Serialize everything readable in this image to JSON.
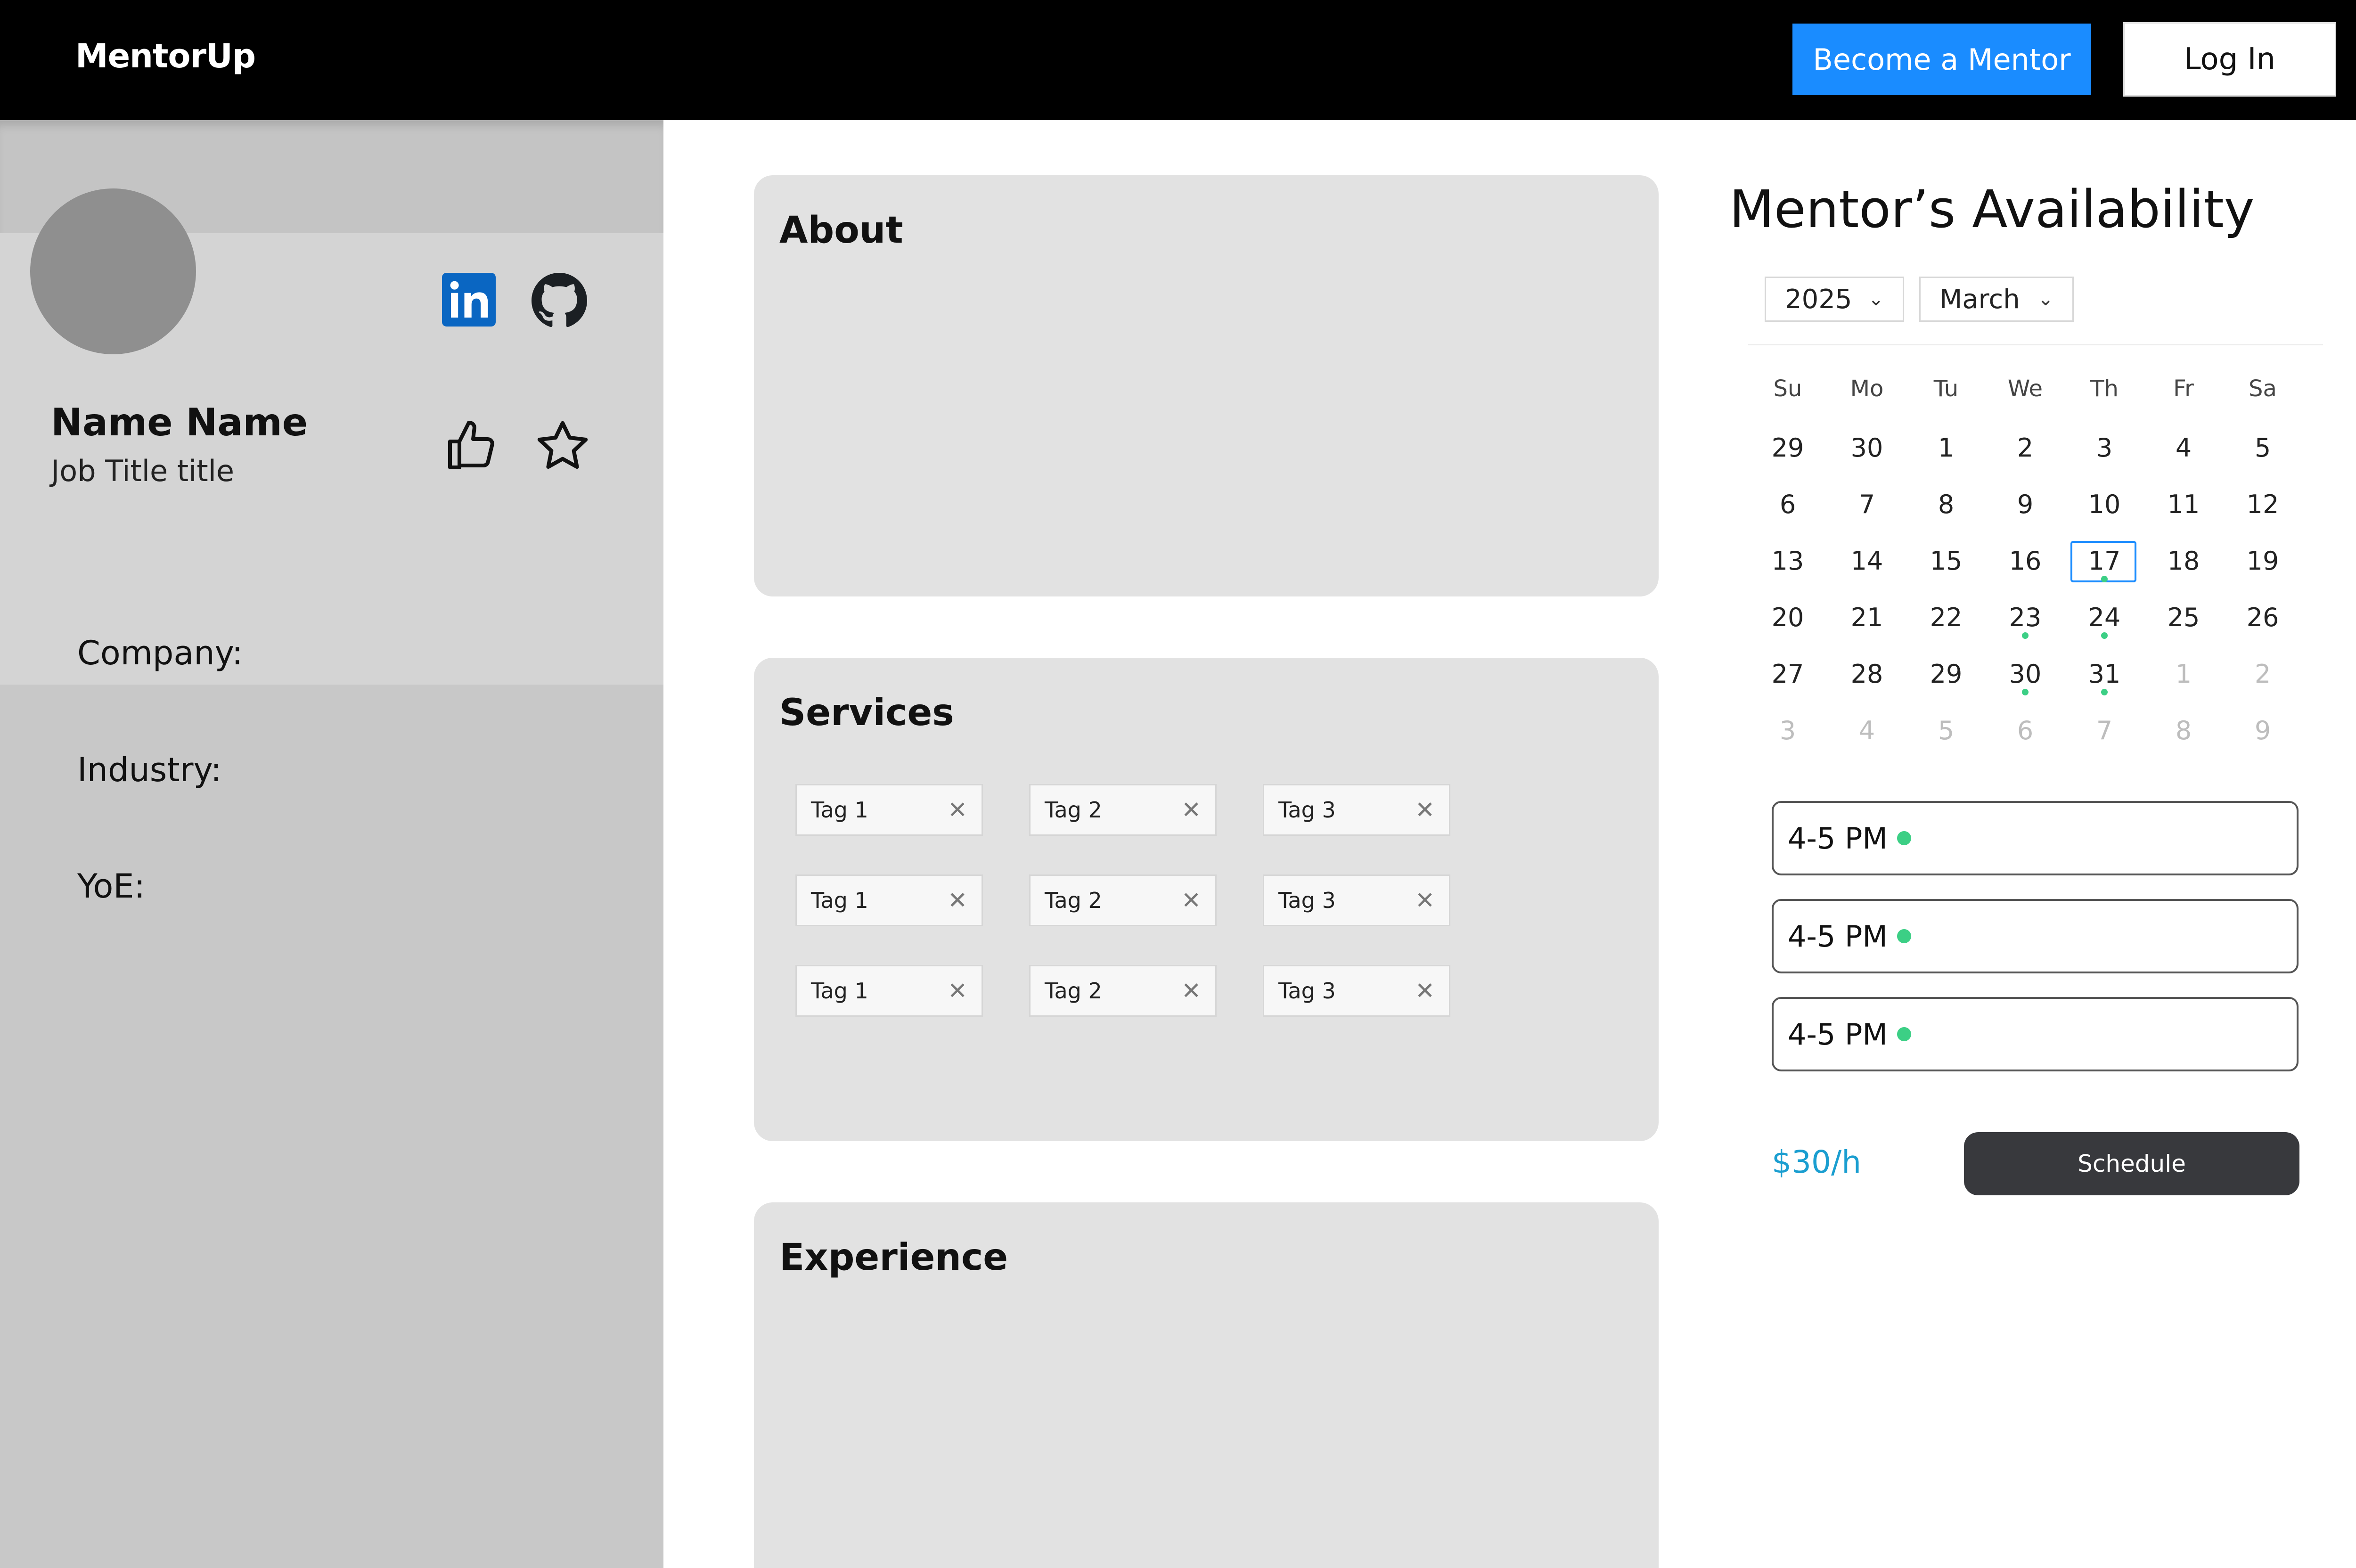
{
  "app": {
    "logo": "MentorUp"
  },
  "header": {
    "become_mentor_label": "Become a Mentor",
    "login_label": "Log In"
  },
  "profile": {
    "name": "Name Name",
    "job_title": "Job Title title",
    "meta": [
      {
        "label": "Company:"
      },
      {
        "label": "Industry:"
      },
      {
        "label": "YoE:"
      }
    ]
  },
  "sections": {
    "about_title": "About",
    "services_title": "Services",
    "experience_title": "Experience"
  },
  "services": {
    "tags": [
      [
        "Tag 1",
        "Tag 2",
        "Tag 3"
      ],
      [
        "Tag 1",
        "Tag 2",
        "Tag 3"
      ],
      [
        "Tag 1",
        "Tag 2",
        "Tag 3"
      ]
    ]
  },
  "availability": {
    "title": "Mentor’s Availability",
    "year": "2025",
    "month": "March",
    "weekdays": [
      "Su",
      "Mo",
      "Tu",
      "We",
      "Th",
      "Fr",
      "Sa"
    ],
    "weeks": [
      [
        "29",
        "30",
        "1",
        "2",
        "3",
        "4",
        "5"
      ],
      [
        "6",
        "7",
        "8",
        "9",
        "10",
        "11",
        "12"
      ],
      [
        "13",
        "14",
        "15",
        "16",
        "17",
        "18",
        "19"
      ],
      [
        "20",
        "21",
        "22",
        "23",
        "24",
        "25",
        "26"
      ],
      [
        "27",
        "28",
        "29",
        "30",
        "31",
        "1",
        "2"
      ],
      [
        "3",
        "4",
        "5",
        "6",
        "7",
        "8",
        "9"
      ]
    ],
    "slots": [
      "4-5 PM",
      "4-5 PM",
      "4-5 PM"
    ],
    "price": "$30/h",
    "schedule_label": "Schedule"
  },
  "colors": {
    "accent": "#1a8cff",
    "available_dot": "#3ccf85",
    "price": "#1a9ed0",
    "linkedin": "#0a66c2"
  }
}
